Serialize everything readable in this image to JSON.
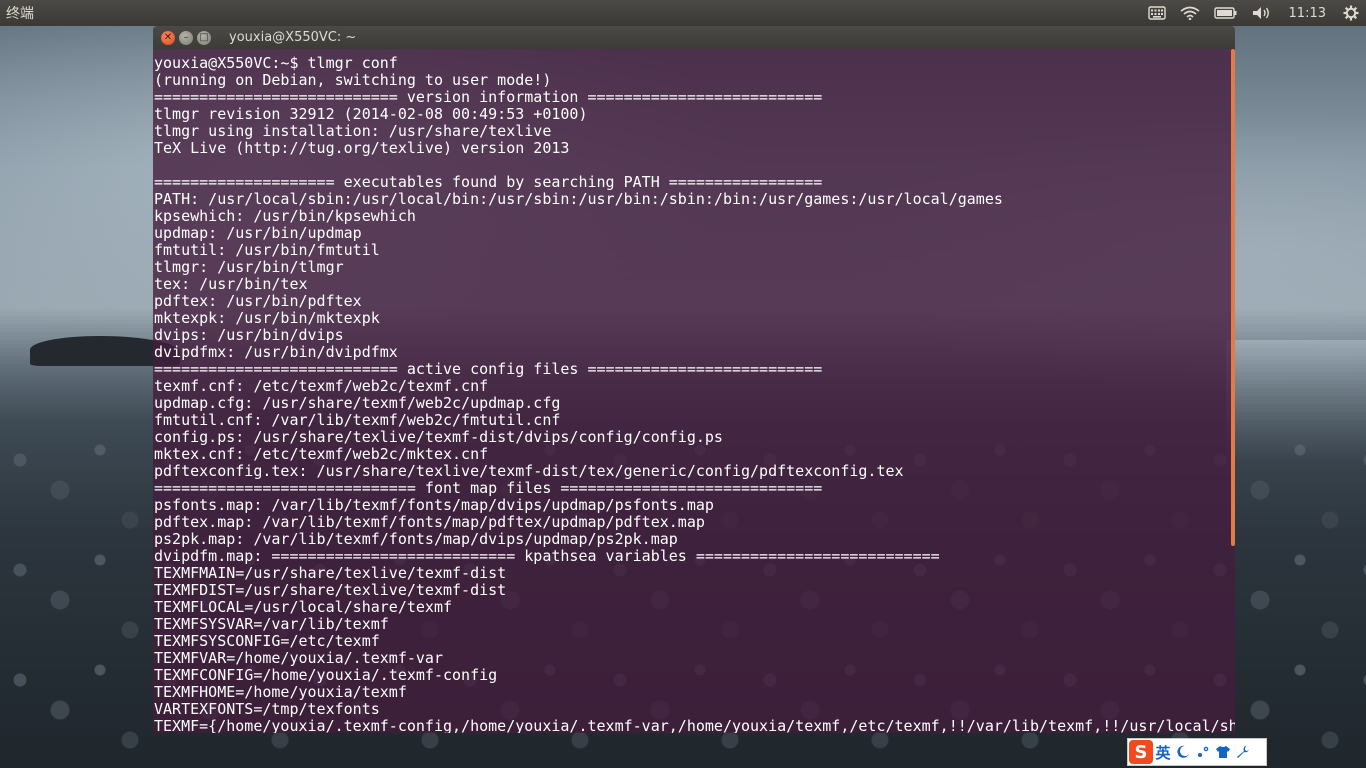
{
  "panel": {
    "title": "终端",
    "clock": "11:13",
    "icons": [
      "keyboard-icon",
      "wifi-icon",
      "battery-icon",
      "volume-icon",
      "gear-icon"
    ]
  },
  "window": {
    "title": "youxia@X550VC: ~",
    "buttons": [
      "close",
      "minimize",
      "maximize"
    ]
  },
  "terminal": {
    "lines": [
      "youxia@X550VC:~$ tlmgr conf",
      "(running on Debian, switching to user mode!)",
      "=========================== version information ==========================",
      "tlmgr revision 32912 (2014-02-08 00:49:53 +0100)",
      "tlmgr using installation: /usr/share/texlive",
      "TeX Live (http://tug.org/texlive) version 2013",
      "",
      "==================== executables found by searching PATH =================",
      "PATH: /usr/local/sbin:/usr/local/bin:/usr/sbin:/usr/bin:/sbin:/bin:/usr/games:/usr/local/games",
      "kpsewhich: /usr/bin/kpsewhich",
      "updmap: /usr/bin/updmap",
      "fmtutil: /usr/bin/fmtutil",
      "tlmgr: /usr/bin/tlmgr",
      "tex: /usr/bin/tex",
      "pdftex: /usr/bin/pdftex",
      "mktexpk: /usr/bin/mktexpk",
      "dvips: /usr/bin/dvips",
      "dvipdfmx: /usr/bin/dvipdfmx",
      "=========================== active config files ==========================",
      "texmf.cnf: /etc/texmf/web2c/texmf.cnf",
      "updmap.cfg: /usr/share/texmf/web2c/updmap.cfg",
      "fmtutil.cnf: /var/lib/texmf/web2c/fmtutil.cnf",
      "config.ps: /usr/share/texlive/texmf-dist/dvips/config/config.ps",
      "mktex.cnf: /etc/texmf/web2c/mktex.cnf",
      "pdftexconfig.tex: /usr/share/texlive/texmf-dist/tex/generic/config/pdftexconfig.tex",
      "============================= font map files =============================",
      "psfonts.map: /var/lib/texmf/fonts/map/dvips/updmap/psfonts.map",
      "pdftex.map: /var/lib/texmf/fonts/map/pdftex/updmap/pdftex.map",
      "ps2pk.map: /var/lib/texmf/fonts/map/dvips/updmap/ps2pk.map",
      "dvipdfm.map: =========================== kpathsea variables ===========================",
      "TEXMFMAIN=/usr/share/texlive/texmf-dist",
      "TEXMFDIST=/usr/share/texlive/texmf-dist",
      "TEXMFLOCAL=/usr/local/share/texmf",
      "TEXMFSYSVAR=/var/lib/texmf",
      "TEXMFSYSCONFIG=/etc/texmf",
      "TEXMFVAR=/home/youxia/.texmf-var",
      "TEXMFCONFIG=/home/youxia/.texmf-config",
      "TEXMFHOME=/home/youxia/texmf",
      "VARTEXFONTS=/tmp/texfonts",
      "TEXMF={/home/youxia/.texmf-config,/home/youxia/.texmf-var,/home/youxia/texmf,/etc/texmf,!!/var/lib/texmf,!!/usr/local/sh"
    ]
  },
  "ime": {
    "logo": "S",
    "language": "英",
    "icons": [
      "moon-icon",
      "punctuation-icon",
      "shirt-icon",
      "wrench-icon"
    ]
  },
  "colors": {
    "terminal_bg": "#441c3c",
    "panel_bg": "#3c3b37",
    "close_button": "#dd4814",
    "scrollbar": "#e27b48"
  }
}
